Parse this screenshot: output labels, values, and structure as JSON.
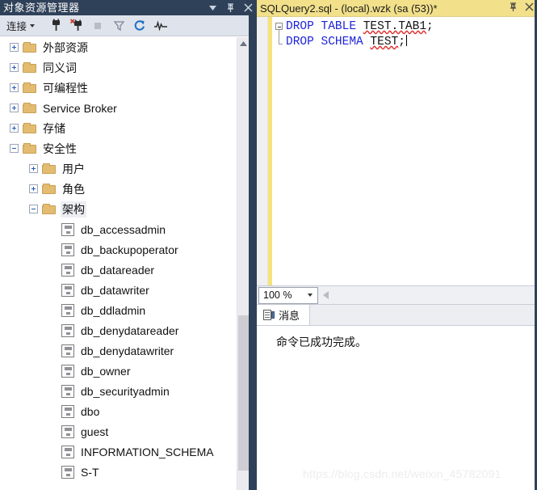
{
  "object_explorer": {
    "title": "对象资源管理器",
    "title_buttons": [
      {
        "name": "window-menu-icon",
        "glyph": "▾"
      },
      {
        "name": "pin-icon",
        "glyph": "⊸"
      },
      {
        "name": "close-icon",
        "glyph": "✕"
      }
    ],
    "toolbar": {
      "connect_label": "连接",
      "buttons": [
        {
          "name": "connect-icon",
          "title": "连接"
        },
        {
          "name": "disconnect-icon",
          "title": "断开连接"
        },
        {
          "name": "stop-icon",
          "title": "停止"
        },
        {
          "name": "filter-icon",
          "title": "筛选器"
        },
        {
          "name": "refresh-icon",
          "title": "刷新"
        },
        {
          "name": "activity-monitor-icon",
          "title": "活动监视器"
        }
      ]
    },
    "tree": [
      {
        "label": "外部资源",
        "indent": 0,
        "expander": "plus",
        "icon": "folder"
      },
      {
        "label": "同义词",
        "indent": 0,
        "expander": "plus",
        "icon": "folder"
      },
      {
        "label": "可编程性",
        "indent": 0,
        "expander": "plus",
        "icon": "folder"
      },
      {
        "label": "Service Broker",
        "indent": 0,
        "expander": "plus",
        "icon": "folder"
      },
      {
        "label": "存储",
        "indent": 0,
        "expander": "plus",
        "icon": "folder"
      },
      {
        "label": "安全性",
        "indent": 0,
        "expander": "minus",
        "icon": "folder"
      },
      {
        "label": "用户",
        "indent": 1,
        "expander": "plus",
        "icon": "folder"
      },
      {
        "label": "角色",
        "indent": 1,
        "expander": "plus",
        "icon": "folder"
      },
      {
        "label": "架构",
        "indent": 1,
        "expander": "minus",
        "icon": "folder",
        "selected": true
      },
      {
        "label": "db_accessadmin",
        "indent": 2,
        "expander": "none",
        "icon": "schema"
      },
      {
        "label": "db_backupoperator",
        "indent": 2,
        "expander": "none",
        "icon": "schema"
      },
      {
        "label": "db_datareader",
        "indent": 2,
        "expander": "none",
        "icon": "schema"
      },
      {
        "label": "db_datawriter",
        "indent": 2,
        "expander": "none",
        "icon": "schema"
      },
      {
        "label": "db_ddladmin",
        "indent": 2,
        "expander": "none",
        "icon": "schema"
      },
      {
        "label": "db_denydatareader",
        "indent": 2,
        "expander": "none",
        "icon": "schema"
      },
      {
        "label": "db_denydatawriter",
        "indent": 2,
        "expander": "none",
        "icon": "schema"
      },
      {
        "label": "db_owner",
        "indent": 2,
        "expander": "none",
        "icon": "schema"
      },
      {
        "label": "db_securityadmin",
        "indent": 2,
        "expander": "none",
        "icon": "schema"
      },
      {
        "label": "dbo",
        "indent": 2,
        "expander": "none",
        "icon": "schema"
      },
      {
        "label": "guest",
        "indent": 2,
        "expander": "none",
        "icon": "schema"
      },
      {
        "label": "INFORMATION_SCHEMA",
        "indent": 2,
        "expander": "none",
        "icon": "schema"
      },
      {
        "label": "S-T",
        "indent": 2,
        "expander": "none",
        "icon": "schema"
      }
    ]
  },
  "editor": {
    "tab_title": "SQLQuery2.sql - (local).wzk (sa (53))*",
    "tab_buttons": [
      {
        "name": "pin-icon",
        "glyph": "⊸"
      },
      {
        "name": "close-icon",
        "glyph": "✕"
      }
    ],
    "lines": [
      {
        "keyword": "DROP TABLE",
        "identifier": "TEST.TAB1",
        "terminator": ";"
      },
      {
        "keyword": "DROP SCHEMA",
        "identifier": "TEST",
        "terminator": ";"
      }
    ],
    "zoom_level": "100 %"
  },
  "results": {
    "tab_label": "消息",
    "message": "命令已成功完成。"
  },
  "watermark": "https://blog.csdn.net/weixin_45782091",
  "colors": {
    "titlebar": "#2f4159",
    "toolbar": "#dfe3ec",
    "tab_active": "#f2e08a",
    "keyword": "#1f23d8",
    "error_squiggle": "#e03030",
    "folder": "#e3bc72",
    "change_bar": "#f6e27a"
  }
}
